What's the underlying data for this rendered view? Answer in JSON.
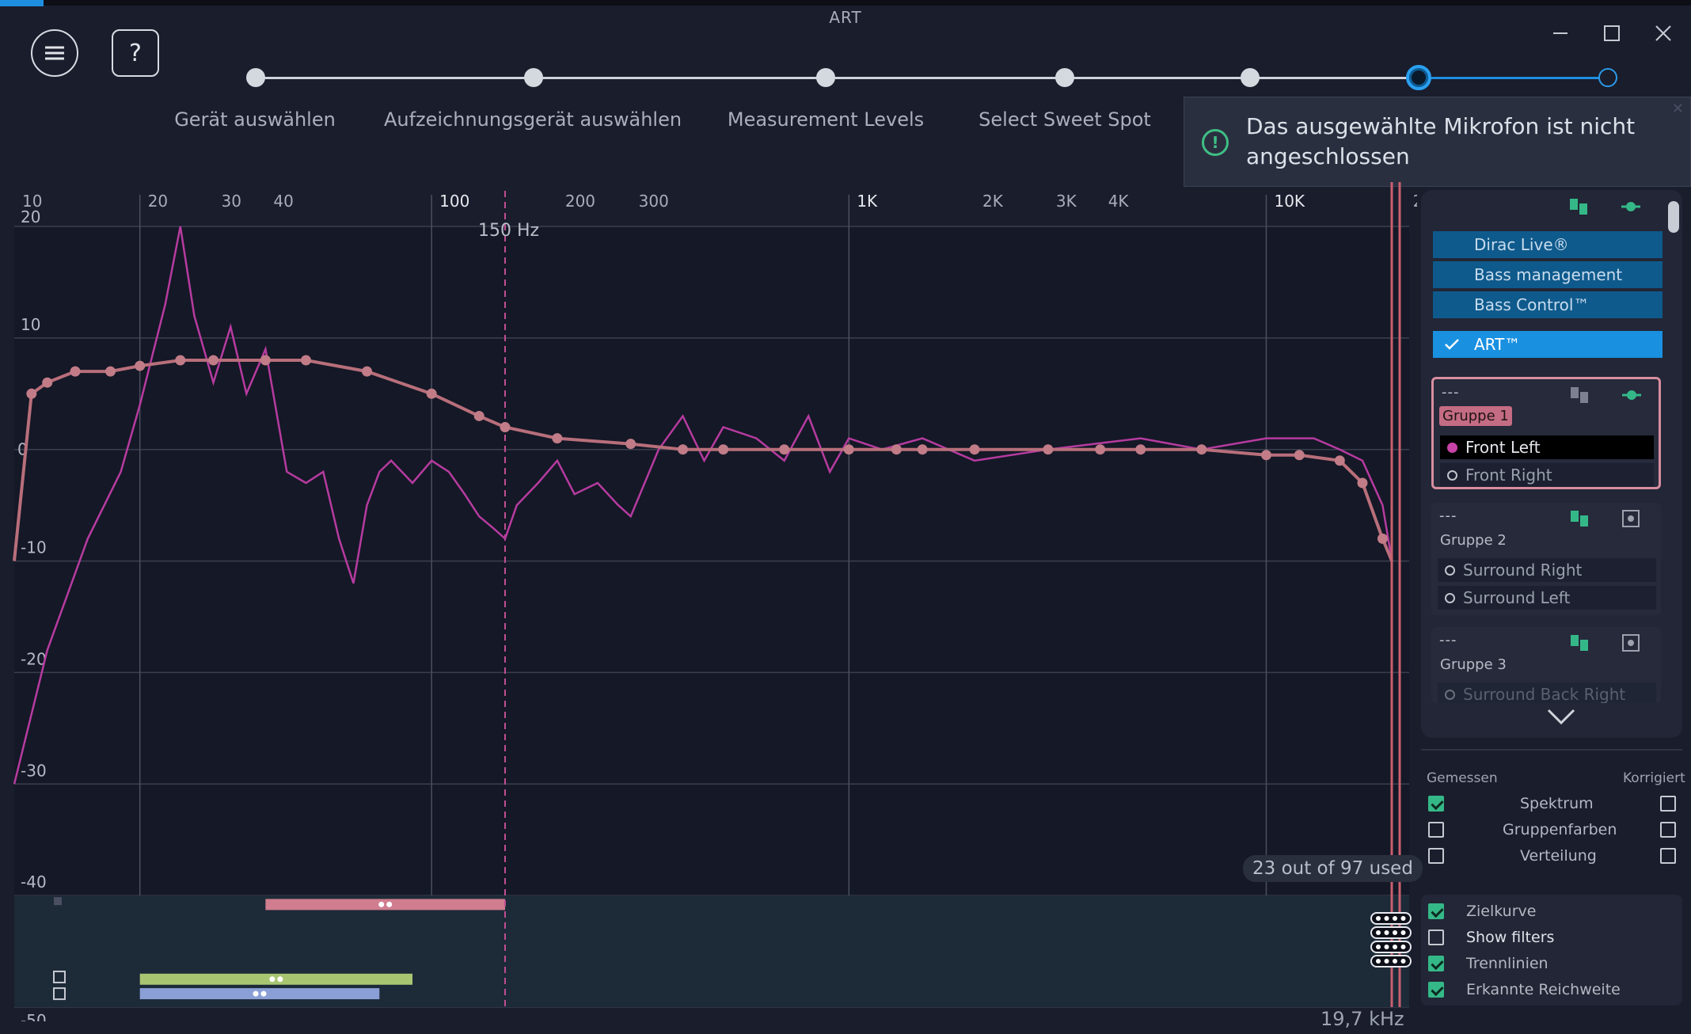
{
  "window": {
    "title": "ART"
  },
  "wizard": {
    "steps": [
      {
        "label": "Gerät auswählen"
      },
      {
        "label": "Aufzeichnungsgerät auswählen"
      },
      {
        "label": "Measurement Levels"
      },
      {
        "label": "Select Sweet Spot"
      }
    ]
  },
  "toast": {
    "text": "Das ausgewählte Mikrofon ist nicht angeschlossen"
  },
  "graph": {
    "x_ticks": [
      "10",
      "20",
      "30",
      "40",
      "100",
      "200",
      "300",
      "1K",
      "2K",
      "3K",
      "4K",
      "10K",
      "2"
    ],
    "y_ticks": [
      "20",
      "10",
      "0",
      "-10",
      "-20",
      "-30",
      "-40",
      "-50"
    ],
    "marker_label": "150 Hz",
    "freq_readout": "19,7 kHz",
    "filters_used": "23 out of 97 used"
  },
  "chart_data": {
    "type": "line",
    "x_scale": "log",
    "xlim": [
      10,
      22000
    ],
    "ylim": [
      -50,
      20
    ],
    "grid": true,
    "marker_line_hz": 150,
    "series": [
      {
        "x": [
          10,
          11,
          12,
          14,
          17,
          20,
          25,
          30,
          40,
          50,
          70,
          100,
          130,
          150,
          200,
          300,
          400,
          500,
          700,
          1000,
          1300,
          1500,
          2000,
          3000,
          4000,
          5000,
          7000,
          10000,
          12000,
          15000,
          17000,
          19000,
          20000
        ],
        "y": [
          -10,
          5,
          6,
          7,
          7,
          7.5,
          8,
          8,
          8,
          8,
          7,
          5,
          3,
          2,
          1,
          0.5,
          0,
          0,
          0,
          0,
          0,
          0,
          0,
          0,
          0,
          0,
          0,
          -0.5,
          -0.5,
          -1,
          -3,
          -8,
          -10
        ]
      },
      {
        "x": [
          10,
          12,
          15,
          18,
          20,
          23,
          25,
          27,
          30,
          33,
          36,
          40,
          45,
          50,
          55,
          60,
          65,
          70,
          75,
          80,
          90,
          100,
          110,
          120,
          130,
          140,
          150,
          160,
          180,
          200,
          220,
          250,
          280,
          300,
          350,
          400,
          450,
          500,
          600,
          700,
          800,
          900,
          1000,
          1200,
          1500,
          2000,
          3000,
          5000,
          7000,
          10000,
          13000,
          15000,
          17000,
          19000,
          20000
        ],
        "y": [
          -30,
          -18,
          -8,
          -2,
          4,
          13,
          20,
          12,
          6,
          11,
          5,
          9,
          -2,
          -3,
          -2,
          -8,
          -12,
          -5,
          -2,
          -1,
          -3,
          -1,
          -2,
          -4,
          -6,
          -7,
          -8,
          -5,
          -3,
          -1,
          -4,
          -3,
          -5,
          -6,
          0,
          3,
          -1,
          2,
          1,
          -1,
          3,
          -2,
          1,
          0,
          1,
          -1,
          0,
          1,
          0,
          1,
          1,
          0,
          -1,
          -5,
          -10
        ]
      }
    ],
    "bars": [
      {
        "start_hz": 40,
        "end_hz": 150
      },
      {
        "start_hz": 20,
        "end_hz": 90
      },
      {
        "start_hz": 20,
        "end_hz": 75
      }
    ]
  },
  "sidebar": {
    "modules": [
      {
        "label": "Dirac Live®"
      },
      {
        "label": "Bass management"
      },
      {
        "label": "Bass Control™"
      },
      {
        "label": "ART™"
      }
    ],
    "groups": [
      {
        "name": "Gruppe 1",
        "speakers": [
          "Front Left",
          "Front Right"
        ]
      },
      {
        "name": "Gruppe 2",
        "speakers": [
          "Surround Right",
          "Surround Left"
        ]
      },
      {
        "name": "Gruppe 3",
        "speakers": [
          "Surround Back Right"
        ]
      }
    ],
    "dots": "---"
  },
  "options": {
    "measured_header": "Gemessen",
    "corrected_header": "Korrigiert",
    "rows": [
      {
        "label": "Spektrum",
        "measured": true,
        "corrected": false
      },
      {
        "label": "Gruppenfarben",
        "measured": false,
        "corrected": false
      },
      {
        "label": "Verteilung",
        "measured": false,
        "corrected": false
      }
    ],
    "toggles": [
      {
        "label": "Zielkurve",
        "on": true
      },
      {
        "label": "Show filters",
        "on": false
      },
      {
        "label": "Trennlinien",
        "on": true
      },
      {
        "label": "Erkannte Reichweite",
        "on": true
      }
    ]
  },
  "colors": {
    "accent": "#1e8fe0",
    "target_curve": "#b86f7b",
    "measured_curve": "#b63ba0",
    "bar_pink": "#d07d8f",
    "bar_green": "#a8c572",
    "bar_blue": "#8a9fd6"
  }
}
